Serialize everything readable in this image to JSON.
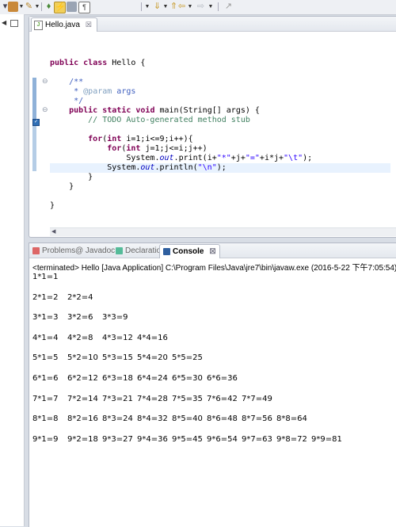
{
  "toolbar": {
    "icons": [
      "palette-icon",
      "pin-icon",
      "dropdown",
      "new-wizard-icon",
      "toggle-mark-icon",
      "block-icon",
      "document-icon",
      "sep",
      "next-annotation-icon",
      "dropdown",
      "prev-annotation-icon",
      "dropdown",
      "back-icon",
      "dropdown",
      "forward-icon",
      "dropdown",
      "sep",
      "pin-editor-icon"
    ]
  },
  "editor": {
    "tab_label": "Hello.java",
    "lines": [
      [
        [
          "kw",
          "public "
        ],
        [
          "kw",
          "class "
        ],
        [
          "pl",
          "Hello {"
        ]
      ],
      [],
      [
        [
          "jd",
          "    /**"
        ]
      ],
      [
        [
          "jd",
          "     * "
        ],
        [
          "jt",
          "@param"
        ],
        [
          "jd",
          " args"
        ]
      ],
      [
        [
          "jd",
          "     */"
        ]
      ],
      [
        [
          "kw",
          "    public "
        ],
        [
          "kw",
          "static "
        ],
        [
          "kw",
          "void "
        ],
        [
          "pl",
          "main(String[] args) {"
        ]
      ],
      [
        [
          "cm",
          "        // TODO Auto-generated method stub"
        ]
      ],
      [],
      [
        [
          "kw",
          "        for"
        ],
        [
          "pl",
          "("
        ],
        [
          "kw",
          "int "
        ],
        [
          "pl",
          "i=1;i<=9;i++){"
        ]
      ],
      [
        [
          "kw",
          "            for"
        ],
        [
          "pl",
          "("
        ],
        [
          "kw",
          "int "
        ],
        [
          "pl",
          "j=1;j<=i;j++)"
        ]
      ],
      [
        [
          "pl",
          "                System."
        ],
        [
          "it",
          "out"
        ],
        [
          "pl",
          ".print(i+"
        ],
        [
          "st",
          "\"*\""
        ],
        [
          "pl",
          "+j+"
        ],
        [
          "st",
          "\"=\""
        ],
        [
          "pl",
          "+i*j+"
        ],
        [
          "st",
          "\"\\t\""
        ],
        [
          "pl",
          ");"
        ]
      ],
      [
        [
          "pl",
          "            System."
        ],
        [
          "it",
          "out"
        ],
        [
          "pl",
          ".println("
        ],
        [
          "st",
          "\"\\n\""
        ],
        [
          "pl",
          ");"
        ]
      ],
      [
        [
          "pl",
          "        }"
        ]
      ],
      [
        [
          "pl",
          "    }"
        ]
      ],
      [],
      [
        [
          "pl",
          "}"
        ]
      ]
    ]
  },
  "console": {
    "tabs": [
      {
        "label": "Problems",
        "icon": "problems-icon"
      },
      {
        "label": "@ Javadoc",
        "icon": ""
      },
      {
        "label": "Declaration",
        "icon": "declaration-icon"
      },
      {
        "label": "Console",
        "icon": "console-icon"
      }
    ],
    "status": "<terminated> Hello [Java Application] C:\\Program Files\\Java\\jre7\\bin\\javaw.exe (2016-5-22 下午7:05:54)",
    "output_rows": [
      [
        "1*1=1"
      ],
      [
        "2*1=2",
        "2*2=4"
      ],
      [
        "3*1=3",
        "3*2=6",
        "3*3=9"
      ],
      [
        "4*1=4",
        "4*2=8",
        "4*3=12",
        "4*4=16"
      ],
      [
        "5*1=5",
        "5*2=10",
        "5*3=15",
        "5*4=20",
        "5*5=25"
      ],
      [
        "6*1=6",
        "6*2=12",
        "6*3=18",
        "6*4=24",
        "6*5=30",
        "6*6=36"
      ],
      [
        "7*1=7",
        "7*2=14",
        "7*3=21",
        "7*4=28",
        "7*5=35",
        "7*6=42",
        "7*7=49"
      ],
      [
        "8*1=8",
        "8*2=16",
        "8*3=24",
        "8*4=32",
        "8*5=40",
        "8*6=48",
        "8*7=56",
        "8*8=64"
      ],
      [
        "9*1=9",
        "9*2=18",
        "9*3=27",
        "9*4=36",
        "9*5=45",
        "9*6=54",
        "9*7=63",
        "9*8=72",
        "9*9=81"
      ]
    ]
  },
  "colors": {
    "keyword": "#7f0055",
    "javadoc": "#3f5fbf",
    "comment": "#3f7f5f",
    "string": "#2a00ff",
    "field": "#0000c0",
    "current_line": "#e8f2fe"
  }
}
